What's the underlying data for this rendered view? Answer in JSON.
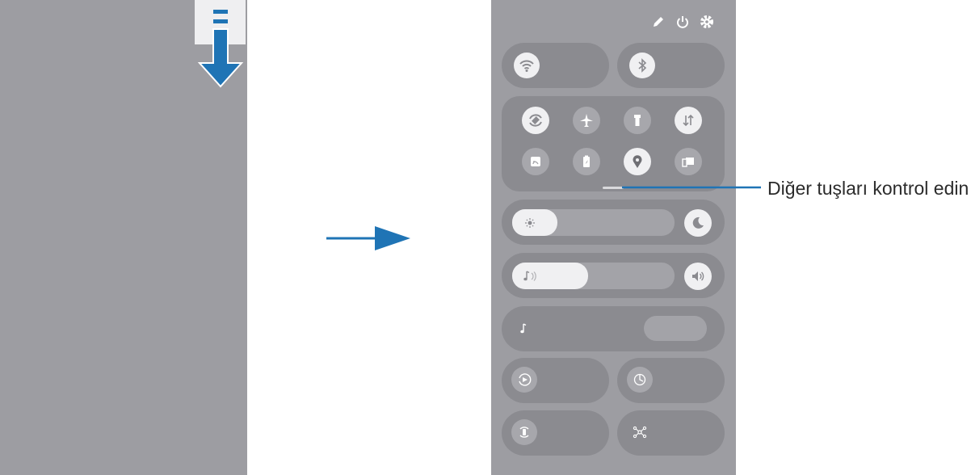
{
  "callout": {
    "text": "Diğer tuşları kontrol edin"
  },
  "icons": {
    "top": [
      "edit-icon",
      "power-icon",
      "settings-icon"
    ],
    "tiles": [
      "wifi-icon",
      "bluetooth-icon"
    ],
    "quick_toggles": [
      "auto-rotate-icon",
      "airplane-icon",
      "flashlight-icon",
      "mobile-data-icon",
      "cast-icon",
      "power-saving-icon",
      "location-icon",
      "link-to-windows-icon"
    ],
    "sliders": [
      "brightness-icon",
      "dark-mode-icon",
      "sound-icon",
      "volume-icon"
    ],
    "media": [
      "music-note-icon"
    ],
    "bottom": [
      "screen-recorder-icon",
      "device-care-icon",
      "smart-view-icon",
      "connected-devices-icon"
    ]
  },
  "levels": {
    "brightness": 0.28,
    "volume": 0.47
  },
  "colors": {
    "arrow_blue": "#1f74b5",
    "panel_gray": "#9d9da2",
    "tile_gray": "#8b8b90",
    "light": "#f0f0f2"
  }
}
